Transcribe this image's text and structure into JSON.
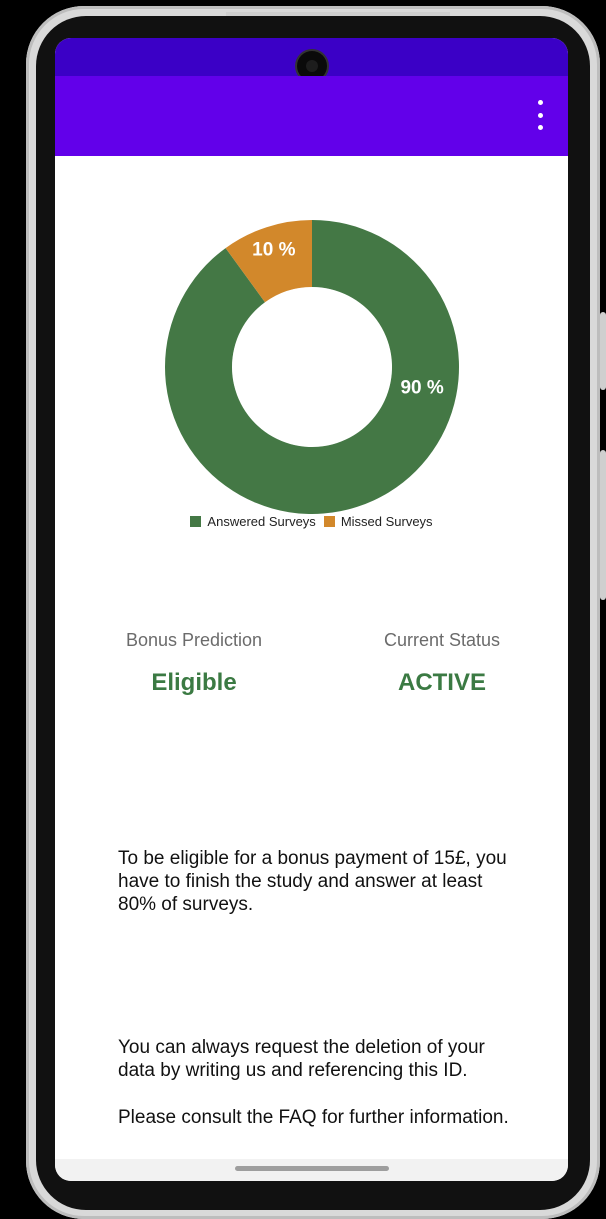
{
  "app_bar": {
    "background": "#6200ea",
    "status_bar_color": "#3b00c6",
    "overflow_icon": "more-vert-icon"
  },
  "chart_data": {
    "type": "pie",
    "style": "donut",
    "categories": [
      "Answered Surveys",
      "Missed Surveys"
    ],
    "values": [
      90,
      10
    ],
    "slice_labels": [
      "90 %",
      "10 %"
    ],
    "colors": [
      "#447845",
      "#d2882b"
    ],
    "legend": [
      "Answered Surveys",
      "Missed Surveys"
    ],
    "legend_position": "bottom-center"
  },
  "stats": {
    "bonus_prediction": {
      "label": "Bonus Prediction",
      "value": "Eligible"
    },
    "current_status": {
      "label": "Current Status",
      "value": "ACTIVE"
    },
    "value_color": "#3b7a43"
  },
  "info": {
    "bonus_text": "To be eligible for a bonus payment of 15£, you have to finish the study and answer at least 80% of surveys.",
    "deletion_text": "You can always request the deletion of your data by writing us and referencing this ID.",
    "faq_text": "Please consult the FAQ for further information."
  }
}
